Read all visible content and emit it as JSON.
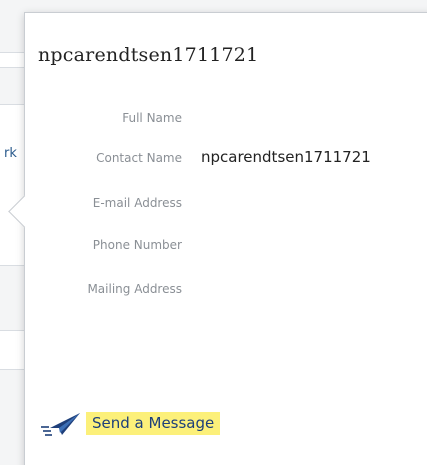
{
  "background": {
    "partial_link_text": "rk"
  },
  "profile": {
    "title": "npcarendtsen1711721",
    "fields": [
      {
        "label": "Full Name",
        "value": ""
      },
      {
        "label": "Contact Name",
        "value": "npcarendtsen1711721"
      },
      {
        "label": "E-mail Address",
        "value": ""
      },
      {
        "label": "Phone Number",
        "value": ""
      },
      {
        "label": "Mailing Address",
        "value": ""
      }
    ]
  },
  "actions": {
    "send_message_label": "Send a Message",
    "send_icon": "paper-plane-icon",
    "highlight_color": "#fcf07a",
    "link_color": "#1c3f7a"
  }
}
